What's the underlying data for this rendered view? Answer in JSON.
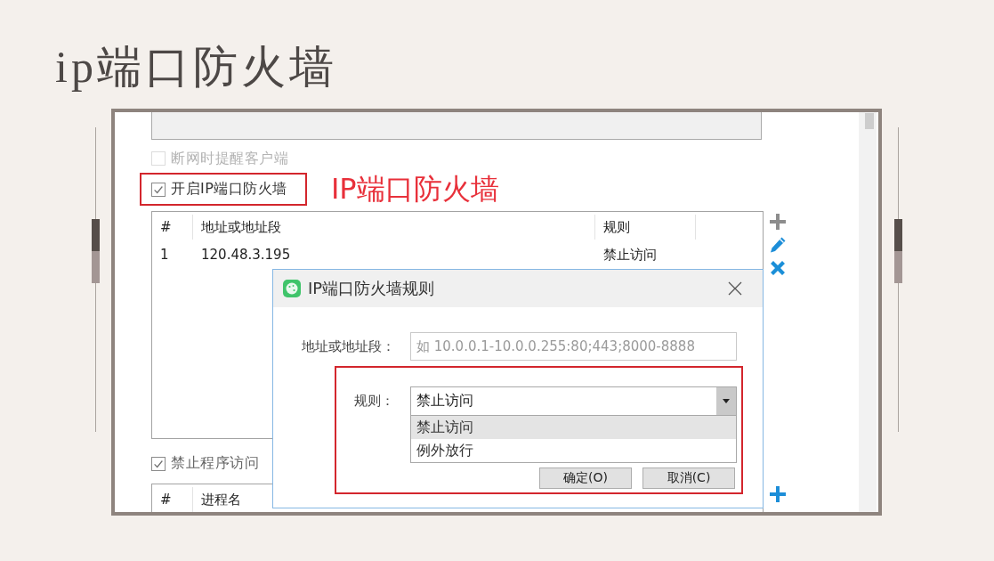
{
  "slide_title": "ip端口防火墙",
  "settings": {
    "reminder_option": {
      "label": "断网时提醒客户端",
      "checked": false,
      "disabled": true,
      "highlighted": false
    },
    "firewall_option": {
      "label": "开启IP端口防火墙",
      "checked": true,
      "disabled": false,
      "highlighted": true
    },
    "annotation": "IP端口防火墙",
    "firewall_table": {
      "columns": [
        "#",
        "地址或地址段",
        "规则"
      ],
      "rows": [
        {
          "cells": [
            "1",
            "120.48.3.195",
            "禁止访问"
          ]
        }
      ]
    },
    "program_option": {
      "label": "禁止程序访问",
      "checked": true,
      "disabled": false,
      "highlighted": false
    },
    "program_table": {
      "columns": [
        "#",
        "进程名"
      ]
    }
  },
  "dialog": {
    "title": "IP端口防火墙规则",
    "address_label": "地址或地址段：",
    "address_placeholder": "如 10.0.0.1-10.0.0.255:80;443;8000-8888",
    "rule_field": {
      "label": "规则：",
      "value": "禁止访问",
      "highlighted": true,
      "expanded": true,
      "options": [
        {
          "label": "禁止访问",
          "selected": true
        },
        {
          "label": "例外放行",
          "selected": false
        }
      ]
    },
    "buttons": [
      "确定(O)",
      "取消(C)"
    ]
  }
}
